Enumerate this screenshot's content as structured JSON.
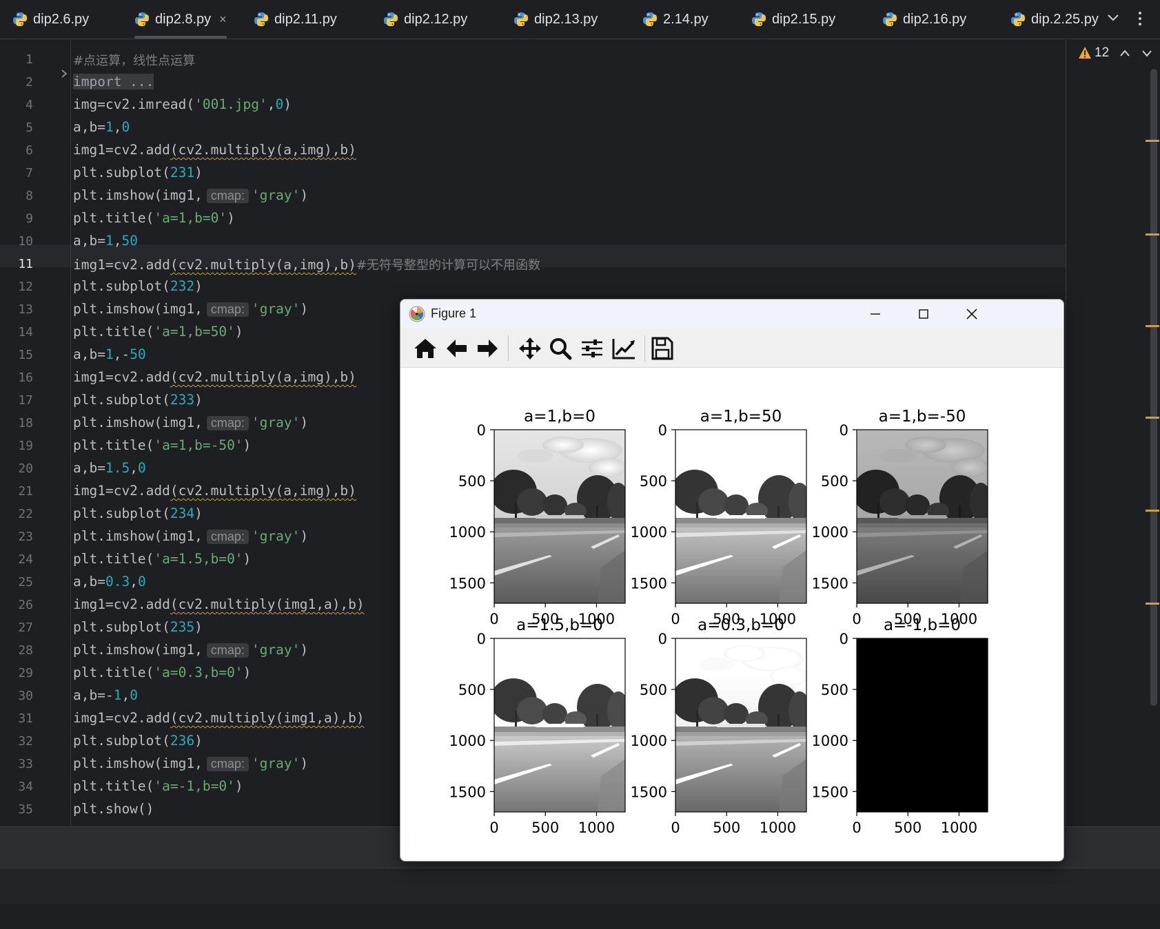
{
  "tabs": [
    {
      "label": "dip2.6.py",
      "active": false,
      "closable": false
    },
    {
      "label": "dip2.8.py",
      "active": true,
      "closable": true
    },
    {
      "label": "dip2.11.py",
      "active": false,
      "closable": false
    },
    {
      "label": "dip2.12.py",
      "active": false,
      "closable": false
    },
    {
      "label": "dip2.13.py",
      "active": false,
      "closable": false
    },
    {
      "label": "2.14.py",
      "active": false,
      "closable": false
    },
    {
      "label": "dip2.15.py",
      "active": false,
      "closable": false
    },
    {
      "label": "dip2.16.py",
      "active": false,
      "closable": false
    },
    {
      "label": "dip.2.25.py",
      "active": false,
      "closable": false
    }
  ],
  "tab_close_glyph": "×",
  "inspections": {
    "warning_count": "12"
  },
  "current_line": "11",
  "editor_lines": [
    {
      "no": "1",
      "tokens": [
        {
          "t": "#点运算，线性点运算",
          "c": "cmt"
        }
      ]
    },
    {
      "no": "2",
      "tokens": [
        {
          "t": "import ...",
          "c": "fold"
        }
      ]
    },
    {
      "no": "4",
      "tokens": [
        {
          "t": "img=cv2.imread("
        },
        {
          "t": "'001.jpg'",
          "c": "str"
        },
        {
          "t": ","
        },
        {
          "t": "0",
          "c": "num"
        },
        {
          "t": ")"
        }
      ]
    },
    {
      "no": "5",
      "tokens": [
        {
          "t": "a,b="
        },
        {
          "t": "1",
          "c": "num"
        },
        {
          "t": ","
        },
        {
          "t": "0",
          "c": "num"
        }
      ]
    },
    {
      "no": "6",
      "tokens": [
        {
          "t": "img1=cv2.add"
        },
        {
          "t": "(cv2.multiply(a,img),b)",
          "c": "sq"
        }
      ]
    },
    {
      "no": "7",
      "tokens": [
        {
          "t": "plt.subplot("
        },
        {
          "t": "231",
          "c": "num"
        },
        {
          "t": ")"
        }
      ]
    },
    {
      "no": "8",
      "tokens": [
        {
          "t": "plt.imshow(img1,"
        },
        {
          "t": "cmap:",
          "c": "hint"
        },
        {
          "t": "'gray'",
          "c": "str"
        },
        {
          "t": ")"
        }
      ]
    },
    {
      "no": "9",
      "tokens": [
        {
          "t": "plt.title("
        },
        {
          "t": "'a=1,b=0'",
          "c": "str"
        },
        {
          "t": ")"
        }
      ]
    },
    {
      "no": "10",
      "tokens": [
        {
          "t": "a,b="
        },
        {
          "t": "1",
          "c": "num"
        },
        {
          "t": ","
        },
        {
          "t": "50",
          "c": "num"
        }
      ]
    },
    {
      "no": "11",
      "tokens": [
        {
          "t": "img1=cv2.add"
        },
        {
          "t": "(cv2.multiply(a,img),b)",
          "c": "sq"
        },
        {
          "t": "#无符号整型的计算可以不用函数",
          "c": "cmt"
        }
      ]
    },
    {
      "no": "12",
      "tokens": [
        {
          "t": "plt.subplot("
        },
        {
          "t": "232",
          "c": "num"
        },
        {
          "t": ")"
        }
      ]
    },
    {
      "no": "13",
      "tokens": [
        {
          "t": "plt.imshow(img1,"
        },
        {
          "t": "cmap:",
          "c": "hint"
        },
        {
          "t": "'gray'",
          "c": "str"
        },
        {
          "t": ")"
        }
      ]
    },
    {
      "no": "14",
      "tokens": [
        {
          "t": "plt.title("
        },
        {
          "t": "'a=1,b=50'",
          "c": "str"
        },
        {
          "t": ")"
        }
      ]
    },
    {
      "no": "15",
      "tokens": [
        {
          "t": "a,b="
        },
        {
          "t": "1",
          "c": "num"
        },
        {
          "t": ",-"
        },
        {
          "t": "50",
          "c": "num"
        }
      ]
    },
    {
      "no": "16",
      "tokens": [
        {
          "t": "img1=cv2.add"
        },
        {
          "t": "(cv2.multiply(a,img),b)",
          "c": "sq"
        }
      ]
    },
    {
      "no": "17",
      "tokens": [
        {
          "t": "plt.subplot("
        },
        {
          "t": "233",
          "c": "num"
        },
        {
          "t": ")"
        }
      ]
    },
    {
      "no": "18",
      "tokens": [
        {
          "t": "plt.imshow(img1,"
        },
        {
          "t": "cmap:",
          "c": "hint"
        },
        {
          "t": "'gray'",
          "c": "str"
        },
        {
          "t": ")"
        }
      ]
    },
    {
      "no": "19",
      "tokens": [
        {
          "t": "plt.title("
        },
        {
          "t": "'a=1,b=-50'",
          "c": "str"
        },
        {
          "t": ")"
        }
      ]
    },
    {
      "no": "20",
      "tokens": [
        {
          "t": "a,b="
        },
        {
          "t": "1.5",
          "c": "num"
        },
        {
          "t": ","
        },
        {
          "t": "0",
          "c": "num"
        }
      ]
    },
    {
      "no": "21",
      "tokens": [
        {
          "t": "img1=cv2.add"
        },
        {
          "t": "(cv2.multiply(a,img),b)",
          "c": "sq"
        }
      ]
    },
    {
      "no": "22",
      "tokens": [
        {
          "t": "plt.subplot("
        },
        {
          "t": "234",
          "c": "num"
        },
        {
          "t": ")"
        }
      ]
    },
    {
      "no": "23",
      "tokens": [
        {
          "t": "plt.imshow(img1,"
        },
        {
          "t": "cmap:",
          "c": "hint"
        },
        {
          "t": "'gray'",
          "c": "str"
        },
        {
          "t": ")"
        }
      ]
    },
    {
      "no": "24",
      "tokens": [
        {
          "t": "plt.title("
        },
        {
          "t": "'a=1.5,b=0'",
          "c": "str"
        },
        {
          "t": ")"
        }
      ]
    },
    {
      "no": "25",
      "tokens": [
        {
          "t": "a,b="
        },
        {
          "t": "0.3",
          "c": "num"
        },
        {
          "t": ","
        },
        {
          "t": "0",
          "c": "num"
        }
      ]
    },
    {
      "no": "26",
      "tokens": [
        {
          "t": "img1=cv2.add"
        },
        {
          "t": "(cv2.multiply(img1,a),b)",
          "c": "sq"
        }
      ]
    },
    {
      "no": "27",
      "tokens": [
        {
          "t": "plt.subplot("
        },
        {
          "t": "235",
          "c": "num"
        },
        {
          "t": ")"
        }
      ]
    },
    {
      "no": "28",
      "tokens": [
        {
          "t": "plt.imshow(img1,"
        },
        {
          "t": "cmap:",
          "c": "hint"
        },
        {
          "t": "'gray'",
          "c": "str"
        },
        {
          "t": ")"
        }
      ]
    },
    {
      "no": "29",
      "tokens": [
        {
          "t": "plt.title("
        },
        {
          "t": "'a=0.3,b=0'",
          "c": "str"
        },
        {
          "t": ")"
        }
      ]
    },
    {
      "no": "30",
      "tokens": [
        {
          "t": "a,b=-"
        },
        {
          "t": "1",
          "c": "num"
        },
        {
          "t": ","
        },
        {
          "t": "0",
          "c": "num"
        }
      ]
    },
    {
      "no": "31",
      "tokens": [
        {
          "t": "img1=cv2.add"
        },
        {
          "t": "(cv2.multiply(img1,a),b)",
          "c": "sq"
        }
      ]
    },
    {
      "no": "32",
      "tokens": [
        {
          "t": "plt.subplot("
        },
        {
          "t": "236",
          "c": "num"
        },
        {
          "t": ")"
        }
      ]
    },
    {
      "no": "33",
      "tokens": [
        {
          "t": "plt.imshow(img1,"
        },
        {
          "t": "cmap:",
          "c": "hint"
        },
        {
          "t": "'gray'",
          "c": "str"
        },
        {
          "t": ")"
        }
      ]
    },
    {
      "no": "34",
      "tokens": [
        {
          "t": "plt.title("
        },
        {
          "t": "'a=-1,b=0'",
          "c": "str"
        },
        {
          "t": ")"
        }
      ]
    },
    {
      "no": "35",
      "tokens": [
        {
          "t": "plt.show()"
        }
      ]
    },
    {
      "no": "36",
      "tokens": []
    }
  ],
  "figure": {
    "window_title": "Figure 1",
    "toolbar": [
      {
        "name": "home-icon"
      },
      {
        "name": "back-icon"
      },
      {
        "name": "forward-icon"
      },
      {
        "name": "pan-icon"
      },
      {
        "name": "zoom-icon"
      },
      {
        "name": "configure-subplots-icon"
      },
      {
        "name": "edit-axis-icon"
      },
      {
        "name": "save-icon"
      }
    ]
  },
  "colors": {
    "editor_bg": "#1e1f22",
    "text": "#bcbec4",
    "number": "#2aacb8",
    "string": "#6aab73",
    "comment": "#7a7e85",
    "warning": "#c9a23b",
    "figure_bg": "#ffffff"
  },
  "chart_data": [
    {
      "type": "image",
      "title": "a=1,b=0",
      "brightness": 1.0,
      "xticks": [
        "0",
        "500",
        "1000"
      ],
      "yticks": [
        "0",
        "500",
        "1000",
        "1500"
      ]
    },
    {
      "type": "image",
      "title": "a=1,b=50",
      "brightness": 1.25,
      "xticks": [
        "0",
        "500",
        "1000"
      ],
      "yticks": [
        "0",
        "500",
        "1000",
        "1500"
      ]
    },
    {
      "type": "image",
      "title": "a=1,b=-50",
      "brightness": 0.8,
      "xticks": [
        "0",
        "500",
        "1000"
      ],
      "yticks": [
        "0",
        "500",
        "1000",
        "1500"
      ]
    },
    {
      "type": "image",
      "title": "a=1.5,b=0",
      "brightness": 1.3,
      "xticks": [
        "0",
        "500",
        "1000"
      ],
      "yticks": [
        "0",
        "500",
        "1000",
        "1500"
      ]
    },
    {
      "type": "image",
      "title": "a=0.3,b=0",
      "brightness": 1.15,
      "xticks": [
        "0",
        "500",
        "1000"
      ],
      "yticks": [
        "0",
        "500",
        "1000",
        "1500"
      ]
    },
    {
      "type": "image",
      "title": "a=-1,b=0",
      "brightness": 0,
      "xticks": [
        "0",
        "500",
        "1000"
      ],
      "yticks": [
        "0",
        "500",
        "1000",
        "1500"
      ]
    }
  ]
}
